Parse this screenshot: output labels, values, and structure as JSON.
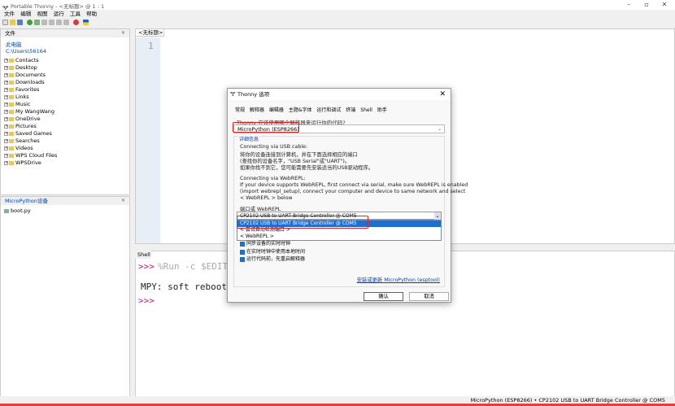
{
  "window": {
    "title": "Portable Thonny  -  <无标题>  @  1 : 1"
  },
  "menu": [
    "文件",
    "编辑",
    "视图",
    "运行",
    "工具",
    "帮助"
  ],
  "files_panel": {
    "header": "文件",
    "location_line1": "此电脑",
    "location_line2": "C:\\Users\\56164",
    "items": [
      "Contacts",
      "Desktop",
      "Documents",
      "Downloads",
      "Favorites",
      "Links",
      "Music",
      "My WangWang",
      "OneDrive",
      "Pictures",
      "Saved Games",
      "Searches",
      "Videos",
      "WPS Cloud Files",
      "WPSDrive"
    ]
  },
  "device_panel": {
    "header": "MicroPython设备",
    "items": [
      "boot.py"
    ]
  },
  "editor": {
    "tab": "<无标题>",
    "line_number": "1"
  },
  "shell": {
    "tab": "Shell",
    "line1_prompt": ">>>",
    "line1_cmd": " %Run -c $EDITO",
    "line2": "MPY: soft reboot",
    "line3_prompt": ">>>"
  },
  "status_bar": {
    "text": "MicroPython (ESP8266)  •  CP2102 USB to UART Bridge Controller @ COM5"
  },
  "dialog": {
    "title": "Thonny 选项",
    "tabs": [
      "常规",
      "解释器",
      "编辑器",
      "主题&字体",
      "运行和调试",
      "终端",
      "Shell",
      "助手"
    ],
    "question": "Thonny 应该使用哪个解释器来运行你的代码?",
    "interpreter": "MicroPython (ESP8266)",
    "details_label": "详细信息",
    "usb_heading": "Connecting via USB cable:",
    "usb_lines": [
      "将你的设备连接到计算机，并在下面选择相应的端口",
      "(查找你的设备名字，\"USB Serial\"或\"UART\")。",
      "如果你找不到它，您可能需要先安装适当的USB驱动程序。"
    ],
    "webrepl_heading": "Connecting via WebREPL:",
    "webrepl_lines": [
      "If your device supports WebREPL, first connect via serial, make sure WebREPL is enabled",
      "(import webrepl_setup), connect your computer and device to same network and select",
      "< WebREPL > below"
    ],
    "port_label": "端口或 WebREPL",
    "port_value": "CP2102 USB to UART Bridge Controller @ COM5",
    "port_options": [
      "CP2102 USB to UART Bridge Controller @ COM5",
      "< 尝试自动检测端口 >",
      "< WebREPL >"
    ],
    "checkboxes": [
      "同步设备的实时时钟",
      "在实时时钟中使用本地时间",
      "运行代码前，先重启解释器"
    ],
    "install_link": "安装或更新 MicroPython (esptool)",
    "ok": "确认",
    "cancel": "取消"
  }
}
